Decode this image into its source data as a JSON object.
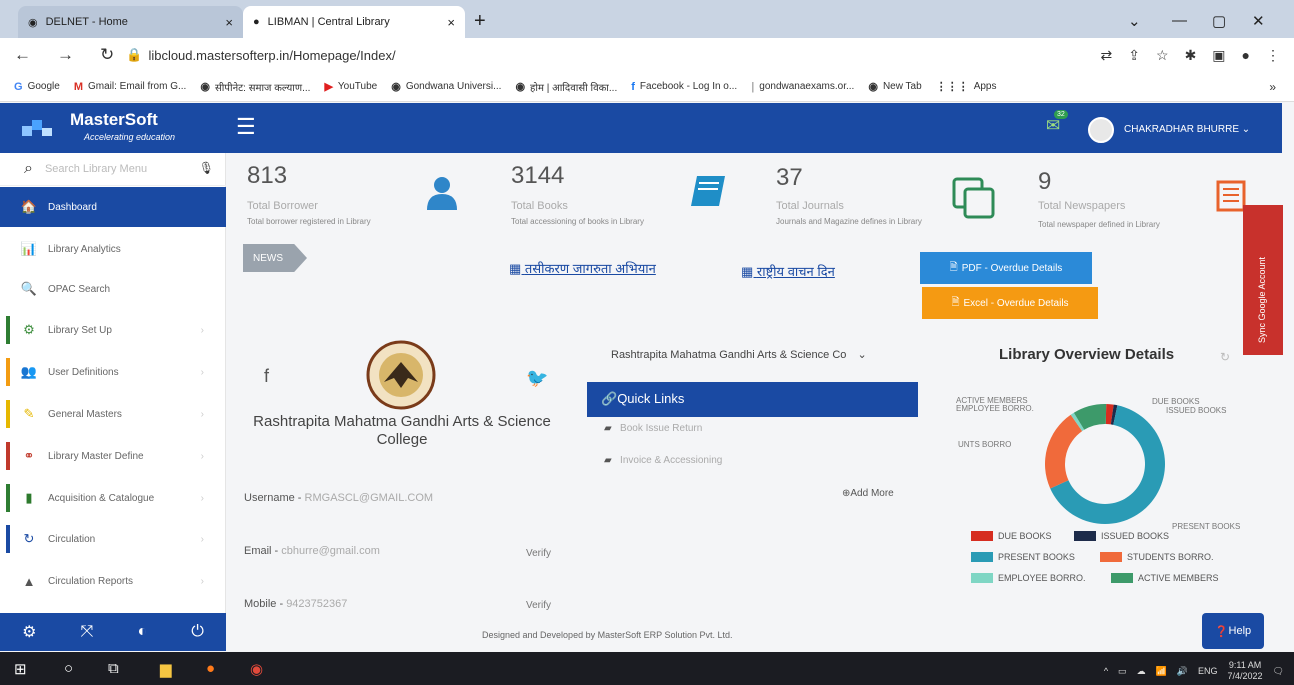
{
  "browser": {
    "tabs": [
      {
        "label": "DELNET - Home",
        "close": "×"
      },
      {
        "label": "LIBMAN | Central Library",
        "close": "×"
      }
    ],
    "new_tab": "+",
    "url": "libcloud.mastersofterp.in/Homepage/Index/",
    "bookmarks": [
      {
        "label": "Google",
        "icon": "G"
      },
      {
        "label": "Gmail: Email from G...",
        "icon": "M"
      },
      {
        "label": "सीपीनेट: समाज कल्याण...",
        "icon": "◉"
      },
      {
        "label": "YouTube",
        "icon": "▶"
      },
      {
        "label": "Gondwana Universi...",
        "icon": "◉"
      },
      {
        "label": "होम | आदिवासी विका...",
        "icon": "◉"
      },
      {
        "label": "Facebook - Log In o...",
        "icon": "f"
      },
      {
        "label": "gondwanaexams.or...",
        "icon": "|"
      },
      {
        "label": "New Tab",
        "icon": "◉"
      },
      {
        "label": "Apps",
        "icon": "⋮⋮⋮"
      }
    ]
  },
  "app": {
    "logo_name": "MasterSoft",
    "logo_tag": "Accelerating education",
    "mail_count": "32",
    "user_name": "CHAKRADHAR BHURRE ⌄"
  },
  "sidebar": {
    "search_placeholder": "Search Library Menu",
    "items": [
      {
        "label": "Dashboard",
        "icon": "🏠",
        "color": "#ffffff"
      },
      {
        "label": "Library Analytics",
        "icon": "📊",
        "color": "#1a4aa3"
      },
      {
        "label": "OPAC Search",
        "icon": "🔍",
        "color": "#d9342b"
      },
      {
        "label": "Library Set Up",
        "icon": "⚙",
        "color": "#3e8e3e"
      },
      {
        "label": "User Definitions",
        "icon": "👥",
        "color": "#f07d1a"
      },
      {
        "label": "General Masters",
        "icon": "✎",
        "color": "#e6b800"
      },
      {
        "label": "Library Master Define",
        "icon": "⚭",
        "color": "#c0392b"
      },
      {
        "label": "Acquisition & Catalogue",
        "icon": "▮",
        "color": "#2d7a2d"
      },
      {
        "label": "Circulation",
        "icon": "↻",
        "color": "#1a4aa3"
      },
      {
        "label": "Circulation Reports",
        "icon": "▲",
        "color": "#555555"
      }
    ],
    "bars": [
      "#2e7d32",
      "#f39c12",
      "#e6b800",
      "#c0392b",
      "#2e7d32",
      "#1a4aa3"
    ]
  },
  "stats": [
    {
      "num": "813",
      "label": "Total Borrower",
      "desc": "Total borrower registered in Library",
      "icon": "user-icon",
      "color": "#2f86c9"
    },
    {
      "num": "3144",
      "label": "Total Books",
      "desc": "Total accessioning of books in Library",
      "icon": "book-icon",
      "color": "#1f8ec7"
    },
    {
      "num": "37",
      "label": "Total Journals",
      "desc": "Journals and Magazine defines in Library",
      "icon": "copy-icon",
      "color": "#2e8b57"
    },
    {
      "num": "9",
      "label": "Total Newspapers",
      "desc": "Total newspaper defined in Library",
      "icon": "newspaper-icon",
      "color": "#e8622c"
    }
  ],
  "news": {
    "tag": "NEWS",
    "links": [
      "तसीकरण जागरुता अभियान",
      "राष्ट्रीय वाचन दिन"
    ]
  },
  "buttons": {
    "pdf": "PDF - Overdue Details",
    "excel": "Excel - Overdue Details"
  },
  "profile": {
    "college": "Rashtrapita Mahatma Gandhi Arts & Science College",
    "username_label": "Username - ",
    "username": "RMGASCL@GMAIL.COM",
    "email_label": "Email - ",
    "email": "cbhurre@gmail.com",
    "mobile_label": "Mobile - ",
    "mobile": "9423752367",
    "verify": "Verify"
  },
  "college_select": "Rashtrapita Mahatma Gandhi Arts & Science Co",
  "quick_links": {
    "title": "Quick Links",
    "items": [
      "Book Issue Return",
      "Invoice & Accessioning"
    ],
    "add_more": "Add More"
  },
  "overview": {
    "title": "Library Overview Details"
  },
  "chart_data": {
    "type": "pie",
    "title": "Library Overview Details",
    "categories": [
      "DUE BOOKS",
      "ISSUED BOOKS",
      "PRESENT BOOKS",
      "STUDENTS BORRO.",
      "EMPLOYEE BORRO.",
      "ACTIVE MEMBERS"
    ],
    "values": [
      2,
      1,
      65,
      22,
      1,
      9
    ],
    "colors": [
      "#d62d20",
      "#1d2b4a",
      "#2a9bb5",
      "#f06a3b",
      "#7fd6c4",
      "#3d9a6a"
    ],
    "callouts": [
      "ACTIVE MEMBERS",
      "EMPLOYEE BORRO.",
      "DUE BOOKS",
      "ISSUED BOOKS",
      "UNTS BORRO",
      "PRESENT BOOKS"
    ]
  },
  "sync_label": "Sync Google Account",
  "footer": "Designed and Developed by MasterSoft ERP Solution Pvt. Ltd.",
  "help": "Help",
  "taskbar": {
    "lang": "ENG",
    "time": "9:11 AM",
    "date": "7/4/2022"
  }
}
